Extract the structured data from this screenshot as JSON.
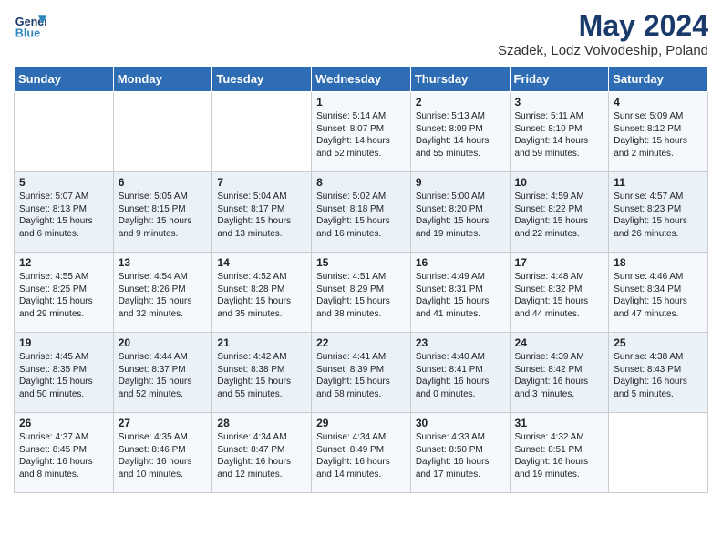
{
  "header": {
    "logo_line1": "General",
    "logo_line2": "Blue",
    "main_title": "May 2024",
    "subtitle": "Szadek, Lodz Voivodeship, Poland"
  },
  "columns": [
    "Sunday",
    "Monday",
    "Tuesday",
    "Wednesday",
    "Thursday",
    "Friday",
    "Saturday"
  ],
  "weeks": [
    [
      {
        "day": "",
        "info": ""
      },
      {
        "day": "",
        "info": ""
      },
      {
        "day": "",
        "info": ""
      },
      {
        "day": "1",
        "info": "Sunrise: 5:14 AM\nSunset: 8:07 PM\nDaylight: 14 hours\nand 52 minutes."
      },
      {
        "day": "2",
        "info": "Sunrise: 5:13 AM\nSunset: 8:09 PM\nDaylight: 14 hours\nand 55 minutes."
      },
      {
        "day": "3",
        "info": "Sunrise: 5:11 AM\nSunset: 8:10 PM\nDaylight: 14 hours\nand 59 minutes."
      },
      {
        "day": "4",
        "info": "Sunrise: 5:09 AM\nSunset: 8:12 PM\nDaylight: 15 hours\nand 2 minutes."
      }
    ],
    [
      {
        "day": "5",
        "info": "Sunrise: 5:07 AM\nSunset: 8:13 PM\nDaylight: 15 hours\nand 6 minutes."
      },
      {
        "day": "6",
        "info": "Sunrise: 5:05 AM\nSunset: 8:15 PM\nDaylight: 15 hours\nand 9 minutes."
      },
      {
        "day": "7",
        "info": "Sunrise: 5:04 AM\nSunset: 8:17 PM\nDaylight: 15 hours\nand 13 minutes."
      },
      {
        "day": "8",
        "info": "Sunrise: 5:02 AM\nSunset: 8:18 PM\nDaylight: 15 hours\nand 16 minutes."
      },
      {
        "day": "9",
        "info": "Sunrise: 5:00 AM\nSunset: 8:20 PM\nDaylight: 15 hours\nand 19 minutes."
      },
      {
        "day": "10",
        "info": "Sunrise: 4:59 AM\nSunset: 8:22 PM\nDaylight: 15 hours\nand 22 minutes."
      },
      {
        "day": "11",
        "info": "Sunrise: 4:57 AM\nSunset: 8:23 PM\nDaylight: 15 hours\nand 26 minutes."
      }
    ],
    [
      {
        "day": "12",
        "info": "Sunrise: 4:55 AM\nSunset: 8:25 PM\nDaylight: 15 hours\nand 29 minutes."
      },
      {
        "day": "13",
        "info": "Sunrise: 4:54 AM\nSunset: 8:26 PM\nDaylight: 15 hours\nand 32 minutes."
      },
      {
        "day": "14",
        "info": "Sunrise: 4:52 AM\nSunset: 8:28 PM\nDaylight: 15 hours\nand 35 minutes."
      },
      {
        "day": "15",
        "info": "Sunrise: 4:51 AM\nSunset: 8:29 PM\nDaylight: 15 hours\nand 38 minutes."
      },
      {
        "day": "16",
        "info": "Sunrise: 4:49 AM\nSunset: 8:31 PM\nDaylight: 15 hours\nand 41 minutes."
      },
      {
        "day": "17",
        "info": "Sunrise: 4:48 AM\nSunset: 8:32 PM\nDaylight: 15 hours\nand 44 minutes."
      },
      {
        "day": "18",
        "info": "Sunrise: 4:46 AM\nSunset: 8:34 PM\nDaylight: 15 hours\nand 47 minutes."
      }
    ],
    [
      {
        "day": "19",
        "info": "Sunrise: 4:45 AM\nSunset: 8:35 PM\nDaylight: 15 hours\nand 50 minutes."
      },
      {
        "day": "20",
        "info": "Sunrise: 4:44 AM\nSunset: 8:37 PM\nDaylight: 15 hours\nand 52 minutes."
      },
      {
        "day": "21",
        "info": "Sunrise: 4:42 AM\nSunset: 8:38 PM\nDaylight: 15 hours\nand 55 minutes."
      },
      {
        "day": "22",
        "info": "Sunrise: 4:41 AM\nSunset: 8:39 PM\nDaylight: 15 hours\nand 58 minutes."
      },
      {
        "day": "23",
        "info": "Sunrise: 4:40 AM\nSunset: 8:41 PM\nDaylight: 16 hours\nand 0 minutes."
      },
      {
        "day": "24",
        "info": "Sunrise: 4:39 AM\nSunset: 8:42 PM\nDaylight: 16 hours\nand 3 minutes."
      },
      {
        "day": "25",
        "info": "Sunrise: 4:38 AM\nSunset: 8:43 PM\nDaylight: 16 hours\nand 5 minutes."
      }
    ],
    [
      {
        "day": "26",
        "info": "Sunrise: 4:37 AM\nSunset: 8:45 PM\nDaylight: 16 hours\nand 8 minutes."
      },
      {
        "day": "27",
        "info": "Sunrise: 4:35 AM\nSunset: 8:46 PM\nDaylight: 16 hours\nand 10 minutes."
      },
      {
        "day": "28",
        "info": "Sunrise: 4:34 AM\nSunset: 8:47 PM\nDaylight: 16 hours\nand 12 minutes."
      },
      {
        "day": "29",
        "info": "Sunrise: 4:34 AM\nSunset: 8:49 PM\nDaylight: 16 hours\nand 14 minutes."
      },
      {
        "day": "30",
        "info": "Sunrise: 4:33 AM\nSunset: 8:50 PM\nDaylight: 16 hours\nand 17 minutes."
      },
      {
        "day": "31",
        "info": "Sunrise: 4:32 AM\nSunset: 8:51 PM\nDaylight: 16 hours\nand 19 minutes."
      },
      {
        "day": "",
        "info": ""
      }
    ]
  ]
}
